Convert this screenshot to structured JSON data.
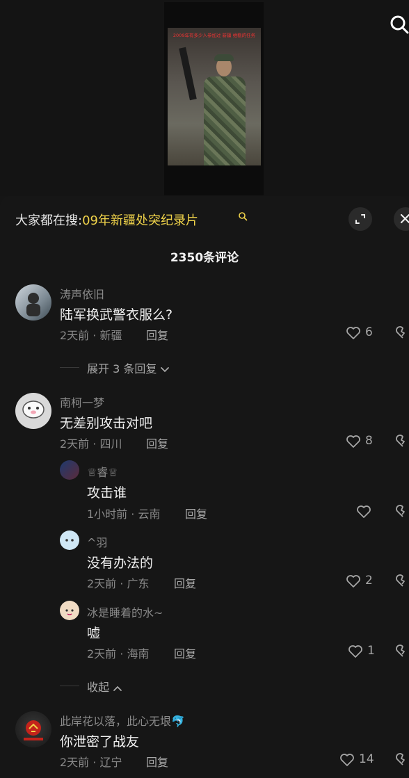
{
  "video": {
    "thumb_caption": "2009年有多少人参加过 新疆 维稳的任务"
  },
  "hot_search": {
    "prefix": "大家都在搜:",
    "term": "09年新疆处突纪录片"
  },
  "comments_count": "2350条评论",
  "reply_label": "回复",
  "comments": [
    {
      "name": "涛声依旧",
      "text": "陆军换武警衣服么?",
      "meta": "2天前 · 新疆",
      "likes": "6",
      "expand_label": "展开 3 条回复"
    },
    {
      "name": "南柯一梦",
      "text": "无差别攻击对吧",
      "meta": "2天前 · 四川",
      "likes": "8",
      "replies": [
        {
          "name": "♕睿♕",
          "text": "攻击谁",
          "meta": "1小时前 · 云南",
          "likes": ""
        },
        {
          "name": "^羽",
          "text": "没有办法的",
          "meta": "2天前 · 广东",
          "likes": "2"
        },
        {
          "name": "冰是睡着的水~",
          "text": "嘘",
          "meta": "2天前 · 海南",
          "likes": "1"
        }
      ],
      "collapse_label": "收起"
    },
    {
      "name": "此岸花以落，此心无垠🐬",
      "text": "你泄密了战友",
      "meta": "2天前 · 辽宁",
      "likes": "14"
    }
  ],
  "colors": {
    "highlight": "#f0d34a",
    "panel": "#161616",
    "muted": "#8a8a8a"
  },
  "icons": [
    "search-icon",
    "expand-icon",
    "close-icon",
    "heart-icon",
    "broken-heart-icon",
    "chevron-down-icon",
    "chevron-up-icon"
  ]
}
